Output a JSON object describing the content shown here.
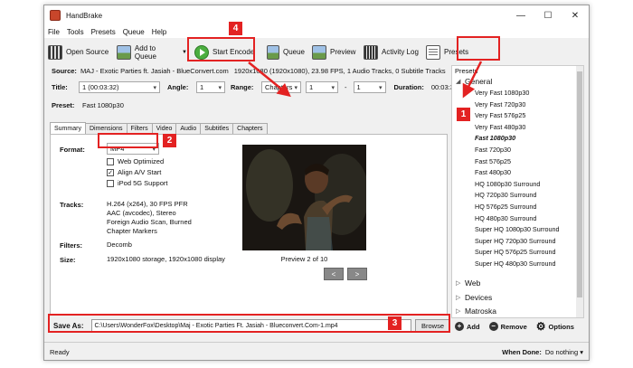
{
  "window": {
    "title": "HandBrake",
    "minimize_glyph": "—",
    "maximize_glyph": "☐",
    "close_glyph": "✕"
  },
  "menu": [
    "File",
    "Tools",
    "Presets",
    "Queue",
    "Help"
  ],
  "toolbar": {
    "open_source": "Open Source",
    "add_to_queue": "Add to Queue",
    "start_encode": "Start Encode",
    "queue": "Queue",
    "preview": "Preview",
    "activity_log": "Activity Log",
    "presets": "Presets"
  },
  "source": {
    "label": "Source:",
    "name": "MAJ - Exotic Parties ft. Jasiah - BlueConvert.com",
    "info": "1920x1080 (1920x1080), 23.98 FPS, 1 Audio Tracks, 0 Subtitle Tracks"
  },
  "title_row": {
    "title_label": "Title:",
    "title_value": "1 (00:03:32)",
    "angle_label": "Angle:",
    "angle_value": "1",
    "range_label": "Range:",
    "range_type": "Chapters",
    "range_from": "1",
    "range_dash": "-",
    "range_to": "1",
    "duration_label": "Duration:",
    "duration_value": "00:03:32"
  },
  "preset_row": {
    "label": "Preset:",
    "value": "Fast 1080p30"
  },
  "tabs": [
    "Summary",
    "Dimensions",
    "Filters",
    "Video",
    "Audio",
    "Subtitles",
    "Chapters"
  ],
  "summary": {
    "format_label": "Format:",
    "format_value": "MP4",
    "web_optimized": "Web Optimized",
    "align_av": "Align A/V Start",
    "ipod": "iPod 5G Support",
    "check_mark": "✓",
    "tracks_label": "Tracks:",
    "tracks": [
      "H.264 (x264), 30 FPS PFR",
      "AAC (avcodec), Stereo",
      "Foreign Audio Scan, Burned",
      "Chapter Markers"
    ],
    "filters_label": "Filters:",
    "filters_value": "Decomb",
    "size_label": "Size:",
    "size_value": "1920x1080 storage, 1920x1080 display",
    "preview_text": "Preview 2 of 10",
    "prev_glyph": "<",
    "next_glyph": ">"
  },
  "save": {
    "label": "Save As:",
    "path": "C:\\Users\\WonderFox\\Desktop\\Maj - Exotic Parties Ft. Jasiah - Blueconvert.Com-1.mp4",
    "browse": "Browse"
  },
  "status": {
    "text": "Ready",
    "when_done_label": "When Done:",
    "when_done_value": "Do nothing ▾"
  },
  "presets_panel": {
    "header": "Presets",
    "group_general": "General",
    "arrow_open": "◢",
    "arrow_closed": "▷",
    "general_items": [
      "Very Fast 1080p30",
      "Very Fast 720p30",
      "Very Fast 576p25",
      "Very Fast 480p30",
      "Fast 1080p30",
      "Fast 720p30",
      "Fast 576p25",
      "Fast 480p30",
      "HQ 1080p30 Surround",
      "HQ 720p30 Surround",
      "HQ 576p25 Surround",
      "HQ 480p30 Surround",
      "Super HQ 1080p30 Surround",
      "Super HQ 720p30 Surround",
      "Super HQ 576p25 Surround",
      "Super HQ 480p30 Surround"
    ],
    "groups_collapsed": [
      "Web",
      "Devices",
      "Matroska"
    ],
    "add": "Add",
    "remove": "Remove",
    "options": "Options",
    "plus_glyph": "+",
    "minus_glyph": "−",
    "gear_glyph": "⚙"
  },
  "annotations": [
    "1",
    "2",
    "3",
    "4"
  ],
  "colors": {
    "highlight": "#e32222",
    "play_green": "#4bae3f"
  }
}
